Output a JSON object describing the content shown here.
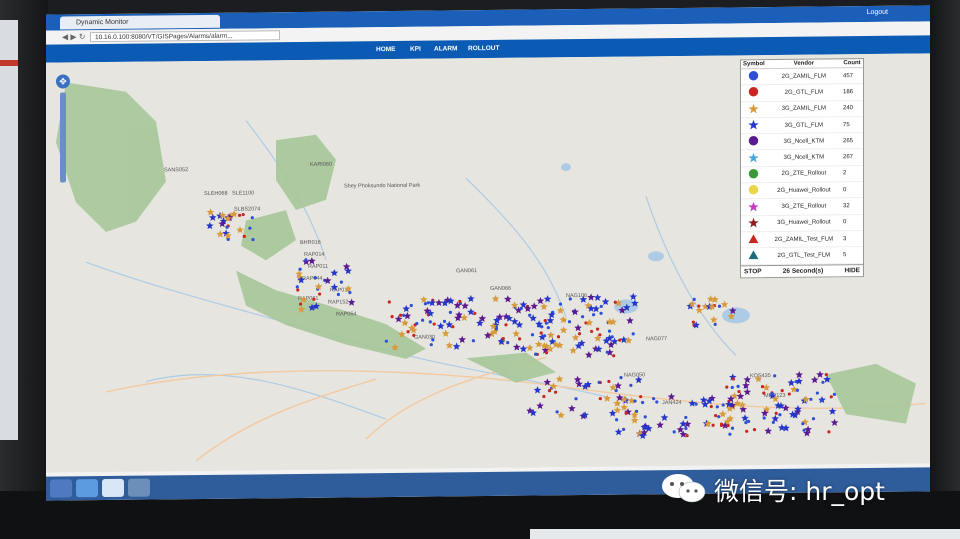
{
  "browser": {
    "tab_title": "Dynamic Monitor",
    "url": "10.16.0.100:8080/VT/GISPages/Alarms/alarm..."
  },
  "app": {
    "logout_label": "Logout",
    "menu": [
      {
        "label": "HOME"
      },
      {
        "label": "KPI"
      },
      {
        "label": "ALARM"
      },
      {
        "label": "ROLLOUT"
      }
    ]
  },
  "map": {
    "labels": [
      {
        "text": "Shey Phoksundo National Park"
      },
      {
        "text": "SANS052"
      },
      {
        "text": "KARI060"
      },
      {
        "text": "SLEH068"
      },
      {
        "text": "SLE1100"
      },
      {
        "text": "SLBS2074"
      },
      {
        "text": "BHR016"
      },
      {
        "text": "RAP014"
      },
      {
        "text": "RAP011"
      },
      {
        "text": "RAP044"
      },
      {
        "text": "RAP018"
      },
      {
        "text": "RAP061"
      },
      {
        "text": "RAP152"
      },
      {
        "text": "RAP064"
      },
      {
        "text": "GAN061"
      },
      {
        "text": "GAN066"
      },
      {
        "text": "GAN030"
      },
      {
        "text": "NAG106"
      },
      {
        "text": "NAG077"
      },
      {
        "text": "NAG050"
      },
      {
        "text": "JAN424"
      },
      {
        "text": "KOS435"
      },
      {
        "text": "MEC123"
      }
    ],
    "colors": {
      "land": "#e7e5df",
      "park": "#a6c79a",
      "water": "#aecbe6",
      "road": "#f2c9a0"
    }
  },
  "legend": {
    "headers": [
      "Symbol",
      "Vendor",
      "Count"
    ],
    "rows": [
      {
        "icon": "blue-circle",
        "color": "#2d50d6",
        "vendor": "2G_ZAMIL_FLM",
        "count": "457"
      },
      {
        "icon": "red-circle",
        "color": "#c8261f",
        "vendor": "2G_GTL_FLM",
        "count": "186"
      },
      {
        "icon": "orange-star",
        "color": "#d79a3c",
        "vendor": "3G_ZAMIL_FLM",
        "count": "240"
      },
      {
        "icon": "blue-star",
        "color": "#2537c9",
        "vendor": "3G_GTL_FLM",
        "count": "75"
      },
      {
        "icon": "purple-circle",
        "color": "#5b1a8f",
        "vendor": "3G_Ncell_KTM",
        "count": "265"
      },
      {
        "icon": "cyan-star",
        "color": "#4aa6d6",
        "vendor": "3G_Ncell_KTM",
        "count": "267"
      },
      {
        "icon": "green-circle",
        "color": "#3a9a3a",
        "vendor": "2G_ZTE_Rollout",
        "count": "2"
      },
      {
        "icon": "yellow-circle",
        "color": "#e9d44a",
        "vendor": "2G_Huawei_Rollout",
        "count": "0"
      },
      {
        "icon": "magenta-star",
        "color": "#c23bc0",
        "vendor": "3G_ZTE_Rollout",
        "count": "32"
      },
      {
        "icon": "darkred-star",
        "color": "#8d1b1b",
        "vendor": "3G_Huawei_Rollout",
        "count": "0"
      },
      {
        "icon": "red-triangle",
        "color": "#c8261f",
        "vendor": "2G_ZAMIL_Test_FLM",
        "count": "3"
      },
      {
        "icon": "teal-triangle",
        "color": "#1d6b7a",
        "vendor": "2G_GTL_Test_FLM",
        "count": "5"
      }
    ],
    "stop_label": "STOP",
    "timer_label": "26 Second(s)",
    "hide_label": "HIDE"
  },
  "watermark": {
    "text": "微信号: hr_opt"
  }
}
